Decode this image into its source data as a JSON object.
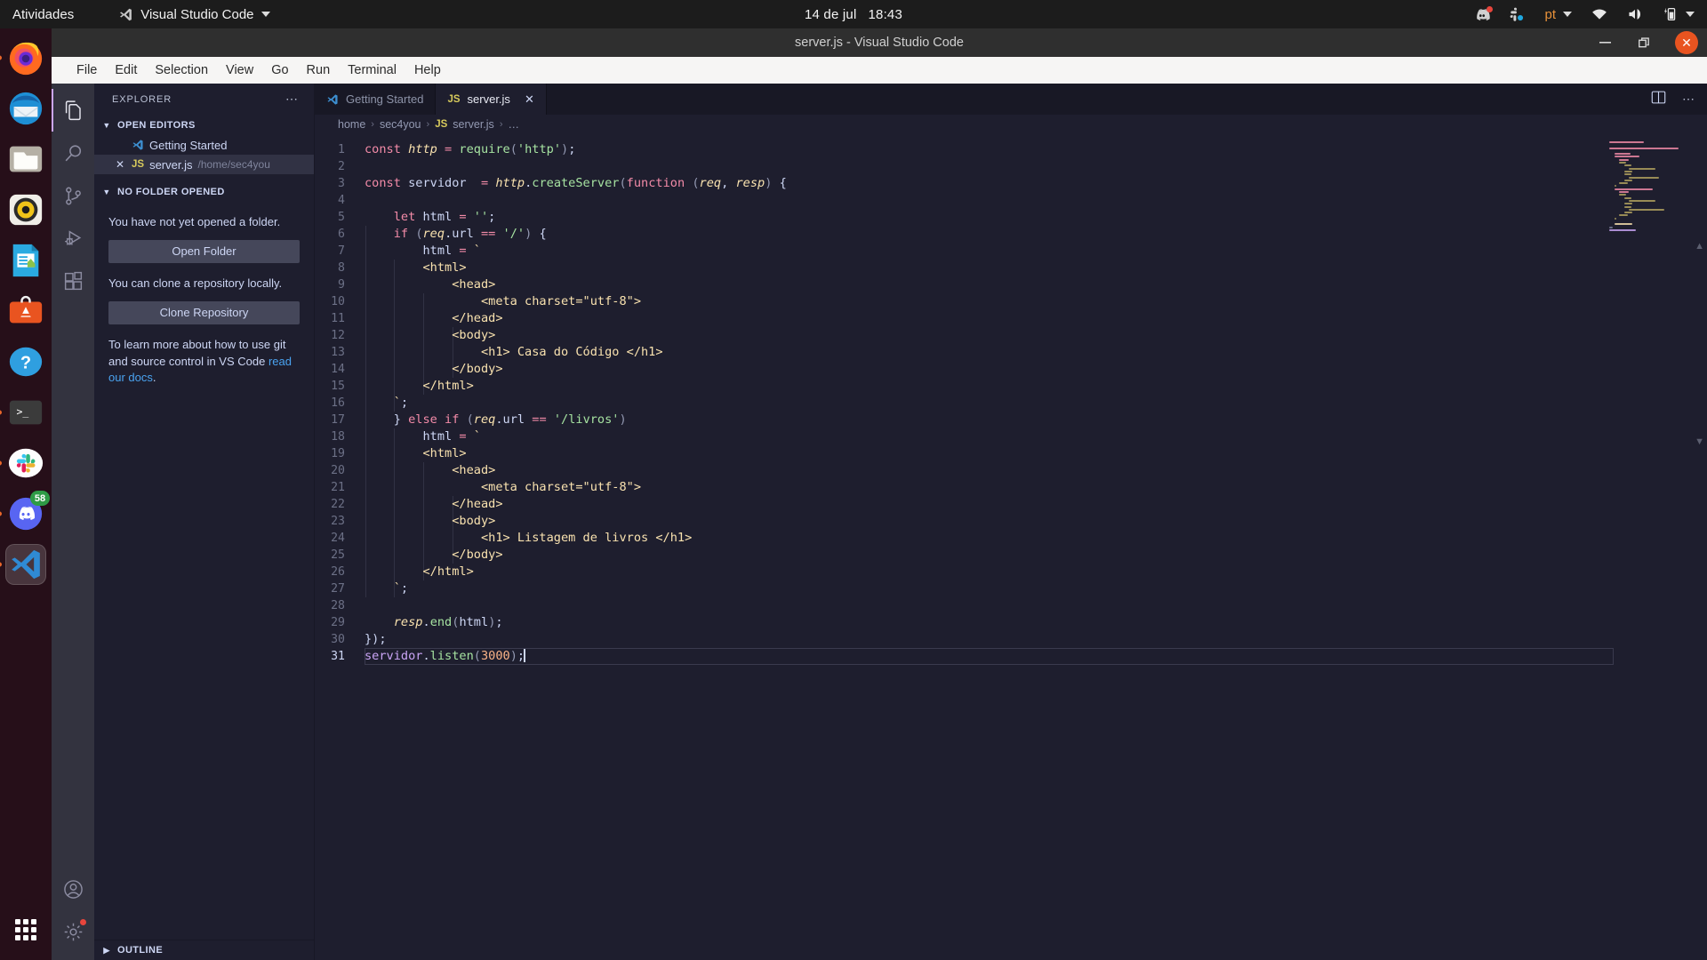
{
  "topbar": {
    "activities": "Atividades",
    "app_name": "Visual Studio Code",
    "app_icon": "vscode-icon",
    "clock_date": "14 de jul",
    "clock_time": "18:43",
    "tray": [
      {
        "name": "discord-tray-icon",
        "badge": true
      },
      {
        "name": "slack-tray-icon",
        "badge": false
      },
      {
        "name": "keyboard-layout",
        "label": "pt"
      },
      {
        "name": "wifi-icon"
      },
      {
        "name": "volume-icon"
      },
      {
        "name": "battery-charging-icon"
      }
    ]
  },
  "dock": {
    "items": [
      {
        "name": "firefox",
        "running": true
      },
      {
        "name": "thunderbird",
        "running": false
      },
      {
        "name": "files",
        "running": false
      },
      {
        "name": "rhythmbox",
        "running": false
      },
      {
        "name": "libreoffice-writer",
        "running": false
      },
      {
        "name": "ubuntu-software",
        "running": false
      },
      {
        "name": "help",
        "running": false
      },
      {
        "name": "terminal",
        "running": true
      },
      {
        "name": "slack",
        "running": true
      },
      {
        "name": "discord",
        "running": true,
        "badge": "58"
      },
      {
        "name": "visual-studio-code",
        "running": true,
        "active": true
      }
    ],
    "show_apps": "show-applications"
  },
  "window": {
    "title": "server.js - Visual Studio Code",
    "minimize": "—",
    "maximize": "❐",
    "close": "✕"
  },
  "menubar": {
    "items": [
      "File",
      "Edit",
      "Selection",
      "View",
      "Go",
      "Run",
      "Terminal",
      "Help"
    ]
  },
  "activitybar": {
    "items": [
      {
        "name": "explorer",
        "icon": "files-icon",
        "selected": true
      },
      {
        "name": "search",
        "icon": "search-icon",
        "selected": false
      },
      {
        "name": "source-control",
        "icon": "source-control-icon",
        "selected": false
      },
      {
        "name": "run-and-debug",
        "icon": "run-debug-icon",
        "selected": false
      },
      {
        "name": "extensions",
        "icon": "extensions-icon",
        "selected": false
      }
    ],
    "bottom": [
      {
        "name": "accounts",
        "icon": "account-icon"
      },
      {
        "name": "manage",
        "icon": "gear-icon",
        "badge": true
      }
    ]
  },
  "sidebar": {
    "title": "EXPLORER",
    "more_actions": "⋯",
    "open_editors": {
      "label": "OPEN EDITORS",
      "items": [
        {
          "label": "Getting Started",
          "icon": "vscode-icon",
          "path": "",
          "selected": false,
          "closable": false
        },
        {
          "label": "server.js",
          "icon": "js-icon",
          "badge": "JS",
          "path": "/home/sec4you",
          "selected": true,
          "closable": true
        }
      ]
    },
    "no_folder": {
      "label": "NO FOLDER OPENED",
      "message_1": "You have not yet opened a folder.",
      "open_folder_button": "Open Folder",
      "message_2": "You can clone a repository locally.",
      "clone_button": "Clone Repository",
      "message_3_pre": "To learn more about how to use git and source control in VS Code ",
      "message_3_link": "read our docs",
      "message_3_post": "."
    },
    "outline": "OUTLINE"
  },
  "editor": {
    "tabs": [
      {
        "label": "Getting Started",
        "icon": "vscode-icon",
        "active": false,
        "closable": false
      },
      {
        "label": "server.js",
        "icon": "js-icon",
        "badge": "JS",
        "active": true,
        "closable": true,
        "close": "✕"
      }
    ],
    "actions": [
      {
        "name": "split-editor-icon"
      },
      {
        "name": "more-actions-icon",
        "label": "⋯"
      }
    ],
    "breadcrumb": [
      "home",
      "sec4you",
      "server.js",
      "…"
    ],
    "breadcrumb_sep": "›",
    "breadcrumb_file_badge": "JS",
    "cursor_line": 31,
    "lines": [
      {
        "n": 1,
        "tokens": [
          {
            "t": "key",
            "v": "const"
          },
          {
            "t": "plain",
            "v": " "
          },
          {
            "t": "var",
            "v": "http"
          },
          {
            "t": "plain",
            "v": " "
          },
          {
            "t": "op",
            "v": "="
          },
          {
            "t": "plain",
            "v": " "
          },
          {
            "t": "fn",
            "v": "require"
          },
          {
            "t": "punc",
            "v": "("
          },
          {
            "t": "str",
            "v": "'http'"
          },
          {
            "t": "punc",
            "v": ")"
          },
          {
            "t": "plain",
            "v": ";"
          }
        ]
      },
      {
        "n": 2,
        "tokens": []
      },
      {
        "n": 3,
        "tokens": [
          {
            "t": "key",
            "v": "const"
          },
          {
            "t": "plain",
            "v": " servidor  "
          },
          {
            "t": "op",
            "v": "="
          },
          {
            "t": "plain",
            "v": " "
          },
          {
            "t": "var",
            "v": "http"
          },
          {
            "t": "plain",
            "v": "."
          },
          {
            "t": "fn",
            "v": "createServer"
          },
          {
            "t": "punc",
            "v": "("
          },
          {
            "t": "key",
            "v": "function"
          },
          {
            "t": "plain",
            "v": " "
          },
          {
            "t": "punc",
            "v": "("
          },
          {
            "t": "var",
            "v": "req"
          },
          {
            "t": "plain",
            "v": ", "
          },
          {
            "t": "var",
            "v": "resp"
          },
          {
            "t": "punc",
            "v": ")"
          },
          {
            "t": "plain",
            "v": " {"
          }
        ]
      },
      {
        "n": 4,
        "tokens": []
      },
      {
        "n": 5,
        "tokens": [
          {
            "t": "plain",
            "v": "    "
          },
          {
            "t": "key",
            "v": "let"
          },
          {
            "t": "plain",
            "v": " html "
          },
          {
            "t": "op",
            "v": "="
          },
          {
            "t": "plain",
            "v": " "
          },
          {
            "t": "str",
            "v": "''"
          },
          {
            "t": "plain",
            "v": ";"
          }
        ]
      },
      {
        "n": 6,
        "tokens": [
          {
            "t": "plain",
            "v": "    "
          },
          {
            "t": "key",
            "v": "if"
          },
          {
            "t": "plain",
            "v": " "
          },
          {
            "t": "punc",
            "v": "("
          },
          {
            "t": "var",
            "v": "req"
          },
          {
            "t": "plain",
            "v": ".url "
          },
          {
            "t": "op",
            "v": "=="
          },
          {
            "t": "plain",
            "v": " "
          },
          {
            "t": "str",
            "v": "'/'"
          },
          {
            "t": "punc",
            "v": ")"
          },
          {
            "t": "plain",
            "v": " {"
          }
        ]
      },
      {
        "n": 7,
        "tokens": [
          {
            "t": "plain",
            "v": "        html "
          },
          {
            "t": "op",
            "v": "="
          },
          {
            "t": "plain",
            "v": " "
          },
          {
            "t": "tpl",
            "v": "`"
          }
        ]
      },
      {
        "n": 8,
        "tokens": [
          {
            "t": "tpl",
            "v": "        <html>"
          }
        ]
      },
      {
        "n": 9,
        "tokens": [
          {
            "t": "tpl",
            "v": "            <head>"
          }
        ]
      },
      {
        "n": 10,
        "tokens": [
          {
            "t": "tpl",
            "v": "                <meta charset=\"utf-8\">"
          }
        ]
      },
      {
        "n": 11,
        "tokens": [
          {
            "t": "tpl",
            "v": "            </head>"
          }
        ]
      },
      {
        "n": 12,
        "tokens": [
          {
            "t": "tpl",
            "v": "            <body>"
          }
        ]
      },
      {
        "n": 13,
        "tokens": [
          {
            "t": "tpl",
            "v": "                <h1> Casa do Código </h1>"
          }
        ]
      },
      {
        "n": 14,
        "tokens": [
          {
            "t": "tpl",
            "v": "            </body>"
          }
        ]
      },
      {
        "n": 15,
        "tokens": [
          {
            "t": "tpl",
            "v": "        </html>"
          }
        ]
      },
      {
        "n": 16,
        "tokens": [
          {
            "t": "tpl",
            "v": "    `"
          },
          {
            "t": "plain",
            "v": ";"
          }
        ]
      },
      {
        "n": 17,
        "tokens": [
          {
            "t": "plain",
            "v": "    }"
          },
          {
            "t": "plain",
            "v": " "
          },
          {
            "t": "key",
            "v": "else if"
          },
          {
            "t": "plain",
            "v": " "
          },
          {
            "t": "punc",
            "v": "("
          },
          {
            "t": "var",
            "v": "req"
          },
          {
            "t": "plain",
            "v": ".url "
          },
          {
            "t": "op",
            "v": "=="
          },
          {
            "t": "plain",
            "v": " "
          },
          {
            "t": "str",
            "v": "'/livros'"
          },
          {
            "t": "punc",
            "v": ")"
          }
        ]
      },
      {
        "n": 18,
        "tokens": [
          {
            "t": "plain",
            "v": "        html "
          },
          {
            "t": "op",
            "v": "="
          },
          {
            "t": "plain",
            "v": " "
          },
          {
            "t": "tpl",
            "v": "`"
          }
        ]
      },
      {
        "n": 19,
        "tokens": [
          {
            "t": "tpl",
            "v": "        <html>"
          }
        ]
      },
      {
        "n": 20,
        "tokens": [
          {
            "t": "tpl",
            "v": "            <head>"
          }
        ]
      },
      {
        "n": 21,
        "tokens": [
          {
            "t": "tpl",
            "v": "                <meta charset=\"utf-8\">"
          }
        ]
      },
      {
        "n": 22,
        "tokens": [
          {
            "t": "tpl",
            "v": "            </head>"
          }
        ]
      },
      {
        "n": 23,
        "tokens": [
          {
            "t": "tpl",
            "v": "            <body>"
          }
        ]
      },
      {
        "n": 24,
        "tokens": [
          {
            "t": "tpl",
            "v": "                <h1> Listagem de livros </h1>"
          }
        ]
      },
      {
        "n": 25,
        "tokens": [
          {
            "t": "tpl",
            "v": "            </body>"
          }
        ]
      },
      {
        "n": 26,
        "tokens": [
          {
            "t": "tpl",
            "v": "        </html>"
          }
        ]
      },
      {
        "n": 27,
        "tokens": [
          {
            "t": "tpl",
            "v": "    `"
          },
          {
            "t": "plain",
            "v": ";"
          }
        ]
      },
      {
        "n": 28,
        "tokens": []
      },
      {
        "n": 29,
        "tokens": [
          {
            "t": "plain",
            "v": "    "
          },
          {
            "t": "var",
            "v": "resp"
          },
          {
            "t": "plain",
            "v": "."
          },
          {
            "t": "fn",
            "v": "end"
          },
          {
            "t": "punc",
            "v": "("
          },
          {
            "t": "plain",
            "v": "html"
          },
          {
            "t": "punc",
            "v": ")"
          },
          {
            "t": "plain",
            "v": ";"
          }
        ]
      },
      {
        "n": 30,
        "tokens": [
          {
            "t": "plain",
            "v": "});"
          }
        ]
      },
      {
        "n": 31,
        "tokens": [
          {
            "t": "id",
            "v": "servidor"
          },
          {
            "t": "plain",
            "v": "."
          },
          {
            "t": "fn",
            "v": "listen"
          },
          {
            "t": "punc",
            "v": "("
          },
          {
            "t": "num",
            "v": "3000"
          },
          {
            "t": "punc",
            "v": ")"
          },
          {
            "t": "plain",
            "v": ";"
          }
        ],
        "active": true
      }
    ]
  },
  "colors": {
    "accent": "#cba6f7",
    "editor_bg": "#1e1e2e",
    "sidebar_bg": "#1e1e2e",
    "activitybar_bg": "#33333f",
    "close_button": "#e95420"
  }
}
